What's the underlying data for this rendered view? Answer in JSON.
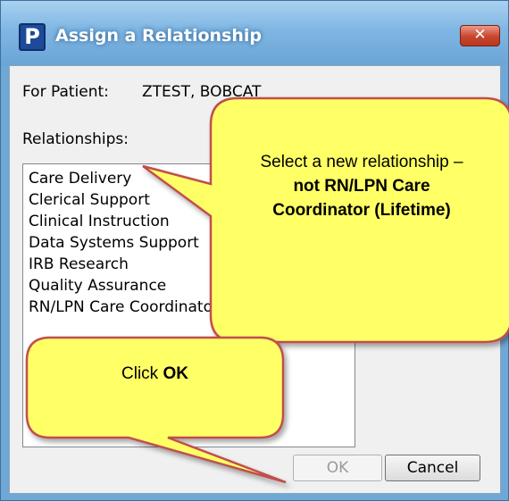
{
  "window": {
    "app_icon_letter": "P",
    "title": "Assign a Relationship",
    "close_glyph": "✕"
  },
  "patient": {
    "label": "For Patient:",
    "name": "ZTEST, BOBCAT"
  },
  "relationships": {
    "label": "Relationships:",
    "items": [
      "Care Delivery",
      "Clerical Support",
      "Clinical Instruction",
      "Data Systems Support",
      "IRB Research",
      "Quality Assurance",
      "RN/LPN Care Coordinator (Lifetime)"
    ]
  },
  "buttons": {
    "ok_label": "OK",
    "cancel_label": "Cancel"
  },
  "callouts": {
    "top": {
      "line1": "Select a new relationship –",
      "line2": "not RN/LPN Care",
      "line3": "Coordinator (Lifetime)"
    },
    "bottom": {
      "prefix": "Click",
      "emphasis": "OK"
    }
  },
  "colors": {
    "callout_fill": "#ffff66",
    "callout_stroke": "#c0504d",
    "title_bar": "#7fb6e3",
    "close_button": "#c8452e"
  }
}
